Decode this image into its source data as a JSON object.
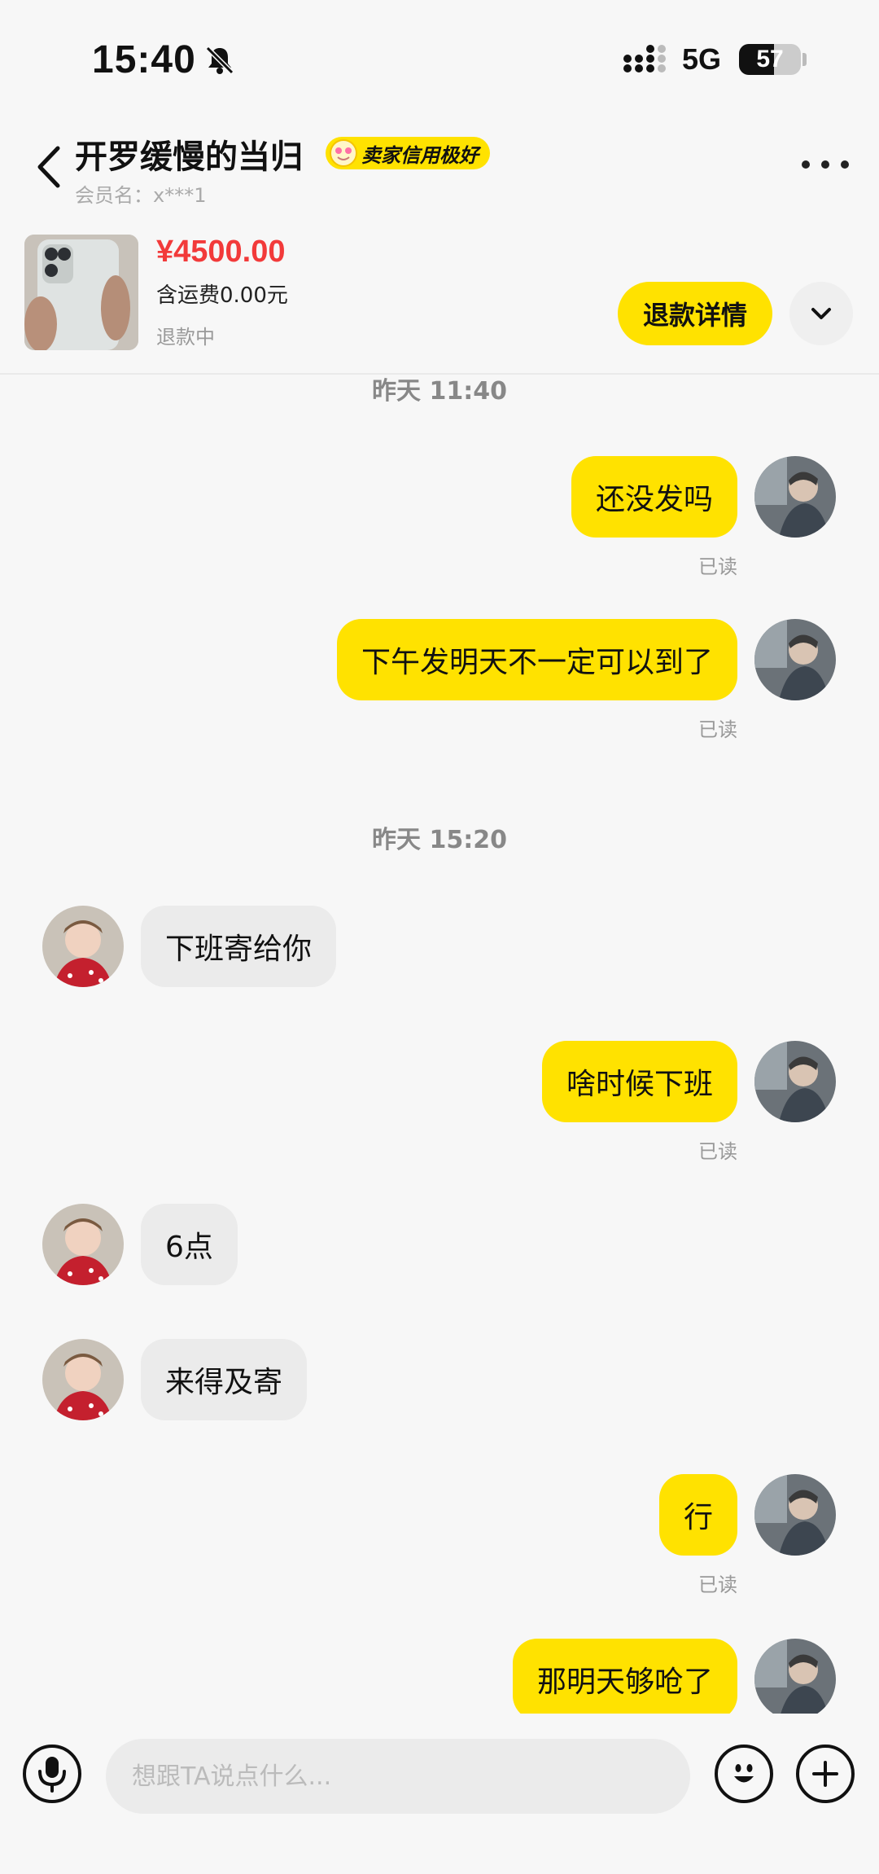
{
  "status_bar": {
    "time": "15:40",
    "network": "5G",
    "battery_percent": 57,
    "battery_text": "57",
    "icons": [
      "bell-off-icon",
      "cellular-signal-icon",
      "battery-icon"
    ]
  },
  "header": {
    "title": "开罗缓慢的当归",
    "badge": "卖家信用极好",
    "member": "会员名：x***1",
    "icons": [
      "back-chevron-icon",
      "more-dots-icon"
    ]
  },
  "product": {
    "price": "¥4500.00",
    "shipping": "含运费0.00元",
    "status": "退款中",
    "refund_button": "退款详情",
    "icons": [
      "phone-thumbnail",
      "chevron-down-icon"
    ]
  },
  "colors": {
    "accent": "#ffe200",
    "price": "#f23a3a",
    "background": "#f7f7f7",
    "peer_bubble": "#ebebeb"
  },
  "chat": {
    "timestamps": [
      "昨天 11:40",
      "昨天 15:20"
    ],
    "messages": [
      {
        "from": "self",
        "text": "还没发吗",
        "status": "已读"
      },
      {
        "from": "self",
        "text": "下午发明天不一定可以到了",
        "status": "已读"
      },
      {
        "from": "peer",
        "text": "下班寄给你"
      },
      {
        "from": "self",
        "text": "啥时候下班",
        "status": "已读"
      },
      {
        "from": "peer",
        "text": "6点"
      },
      {
        "from": "peer",
        "text": "来得及寄"
      },
      {
        "from": "self",
        "text": "行",
        "status": "已读"
      },
      {
        "from": "self",
        "text": "那明天够呛了"
      }
    ]
  },
  "input": {
    "placeholder": "想跟TA说点什么...",
    "icons": [
      "microphone-icon",
      "emoji-icon",
      "plus-icon"
    ]
  }
}
